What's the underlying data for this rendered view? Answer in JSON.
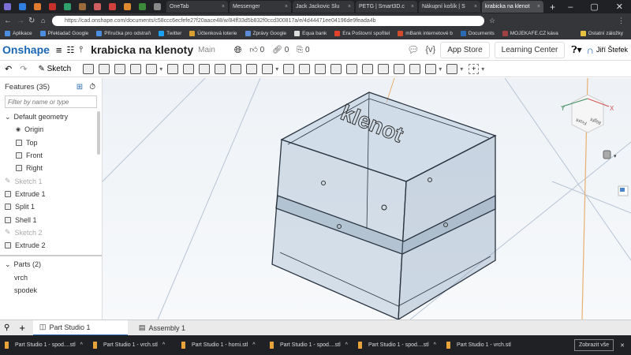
{
  "browser": {
    "tabs": [
      {
        "label": "OneTab"
      },
      {
        "label": "Messenger"
      },
      {
        "label": "Jack Jackovic Slu"
      },
      {
        "label": "PETG | Smart3D.c"
      },
      {
        "label": "Nákupní košík | S"
      },
      {
        "label": "krabicka na klenot",
        "active": true
      }
    ],
    "url": "https://cad.onshape.com/documents/c58ccc6ecfefe27f20aace48/w/84ff33d5b832f0ccd300817a/e/4d44471ee04196de9feada4b",
    "bookmarks": [
      "Aplikace",
      "Překladač Google",
      "Příručka pro odstraň",
      "Twitter",
      "Účtenková loterie",
      "Zprávy Google",
      "Equa bank",
      "Era Poštovní spořitel",
      "mBank internetové b",
      "Documents",
      "MOJEKAFE.CZ káva",
      "Ostatní záložky"
    ]
  },
  "header": {
    "logo": "Onshape",
    "document": "krabicka na klenoty",
    "branch": "Main",
    "likes": "0",
    "links": "0",
    "copies": "0",
    "app_store": "App Store",
    "learning_center": "Learning Center",
    "user": "Jiří Štefek"
  },
  "toolbar": {
    "sketch": "Sketch"
  },
  "features": {
    "title": "Features (35)",
    "filter_placeholder": "Filter by name or type",
    "group": "Default geometry",
    "items": [
      {
        "label": "Origin",
        "type": "origin"
      },
      {
        "label": "Top",
        "type": "plane"
      },
      {
        "label": "Front",
        "type": "plane"
      },
      {
        "label": "Right",
        "type": "plane"
      },
      {
        "label": "Sketch 1",
        "type": "sketch"
      },
      {
        "label": "Extrude 1",
        "type": "feat"
      },
      {
        "label": "Split 1",
        "type": "feat"
      },
      {
        "label": "Shell 1",
        "type": "feat"
      },
      {
        "label": "Sketch 2",
        "type": "sketch"
      },
      {
        "label": "Extrude 2",
        "type": "feat"
      }
    ],
    "parts_title": "Parts (2)",
    "parts": [
      "vrch",
      "spodek"
    ]
  },
  "viewport": {
    "engraving": "klenot",
    "cube_front": "Front",
    "cube_right": "Right",
    "axis_x": "X",
    "axis_y": "Y"
  },
  "bottom_tabs": [
    "Part Studio 1",
    "Assembly 1"
  ],
  "downloads": {
    "items": [
      "Part Studio 1 - spod....stl",
      "Part Studio 1 - vrch.stl",
      "Part Studio 1 - horni.stl",
      "Part Studio 1 - spod....stl",
      "Part Studio 1 - spod....stl",
      "Part Studio 1 - vrch.stl"
    ],
    "show_all": "Zobrazit vše"
  }
}
